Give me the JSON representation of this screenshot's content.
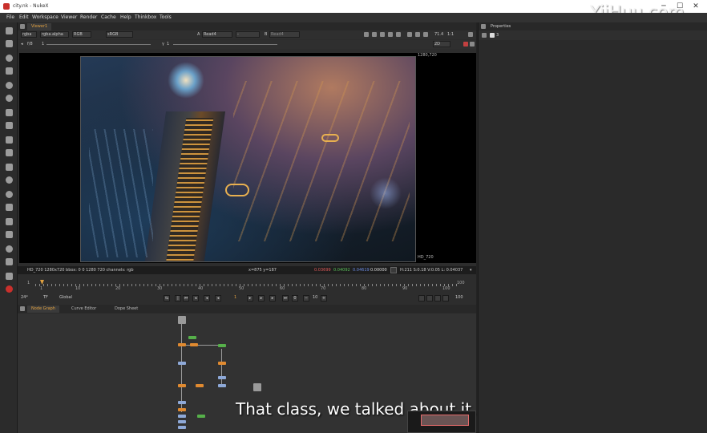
{
  "window": {
    "title": "city.nk - NukeX",
    "minimize": "─",
    "maximize": "☐",
    "close": "✕",
    "watermark": "YiiHuu.com"
  },
  "menu": [
    "File",
    "Edit",
    "Workspace",
    "Viewer",
    "Render",
    "Cache",
    "Help",
    "Thinkbox",
    "Tools"
  ],
  "viewer": {
    "tab_label": "Viewer1",
    "channels": "rgba",
    "alpha": "rgba.alpha",
    "colorspace_mode": "RGB",
    "lut": "sRGB",
    "input_a_label": "A",
    "input_a": "Read4",
    "compare_op": "-",
    "input_b_label": "B",
    "input_b": "Read4",
    "zoom": "71.4",
    "scale": "1:1",
    "gain_label": "f/8",
    "gain_value": "1",
    "gamma_value": "1",
    "view_mode": "2D",
    "format_top": "1280,720",
    "format_bottom": "HD_720",
    "info": {
      "format": "HD_720 1280x720  bbox: 0 0 1280 720 channels: rgb",
      "coords": "x=875 y=187",
      "r": "0.03699",
      "g": "0.04092",
      "b": "0.04619",
      "a": "0.00000",
      "hsvl": "H:211 S:0.18 V:0.05  L: 0.04037"
    },
    "colors": {
      "r": "#e05a5a",
      "g": "#5ac05a",
      "b": "#6a8ae0",
      "accent": "#e0a040"
    }
  },
  "timeline": {
    "start": "1",
    "end": "100",
    "ticks": [
      "1",
      "10",
      "20",
      "30",
      "40",
      "50",
      "60",
      "70",
      "80",
      "90",
      "100"
    ],
    "fps": "24*",
    "tf": "TF",
    "range": "Global",
    "current_frame": "1",
    "step": "10",
    "end_frame": "100"
  },
  "panels": {
    "node_graph": "Node Graph",
    "curve_editor": "Curve Editor",
    "dope_sheet": "Dope Sheet",
    "properties": "Properties",
    "properties_count": "3"
  },
  "subtitle": "That class, we talked about it."
}
